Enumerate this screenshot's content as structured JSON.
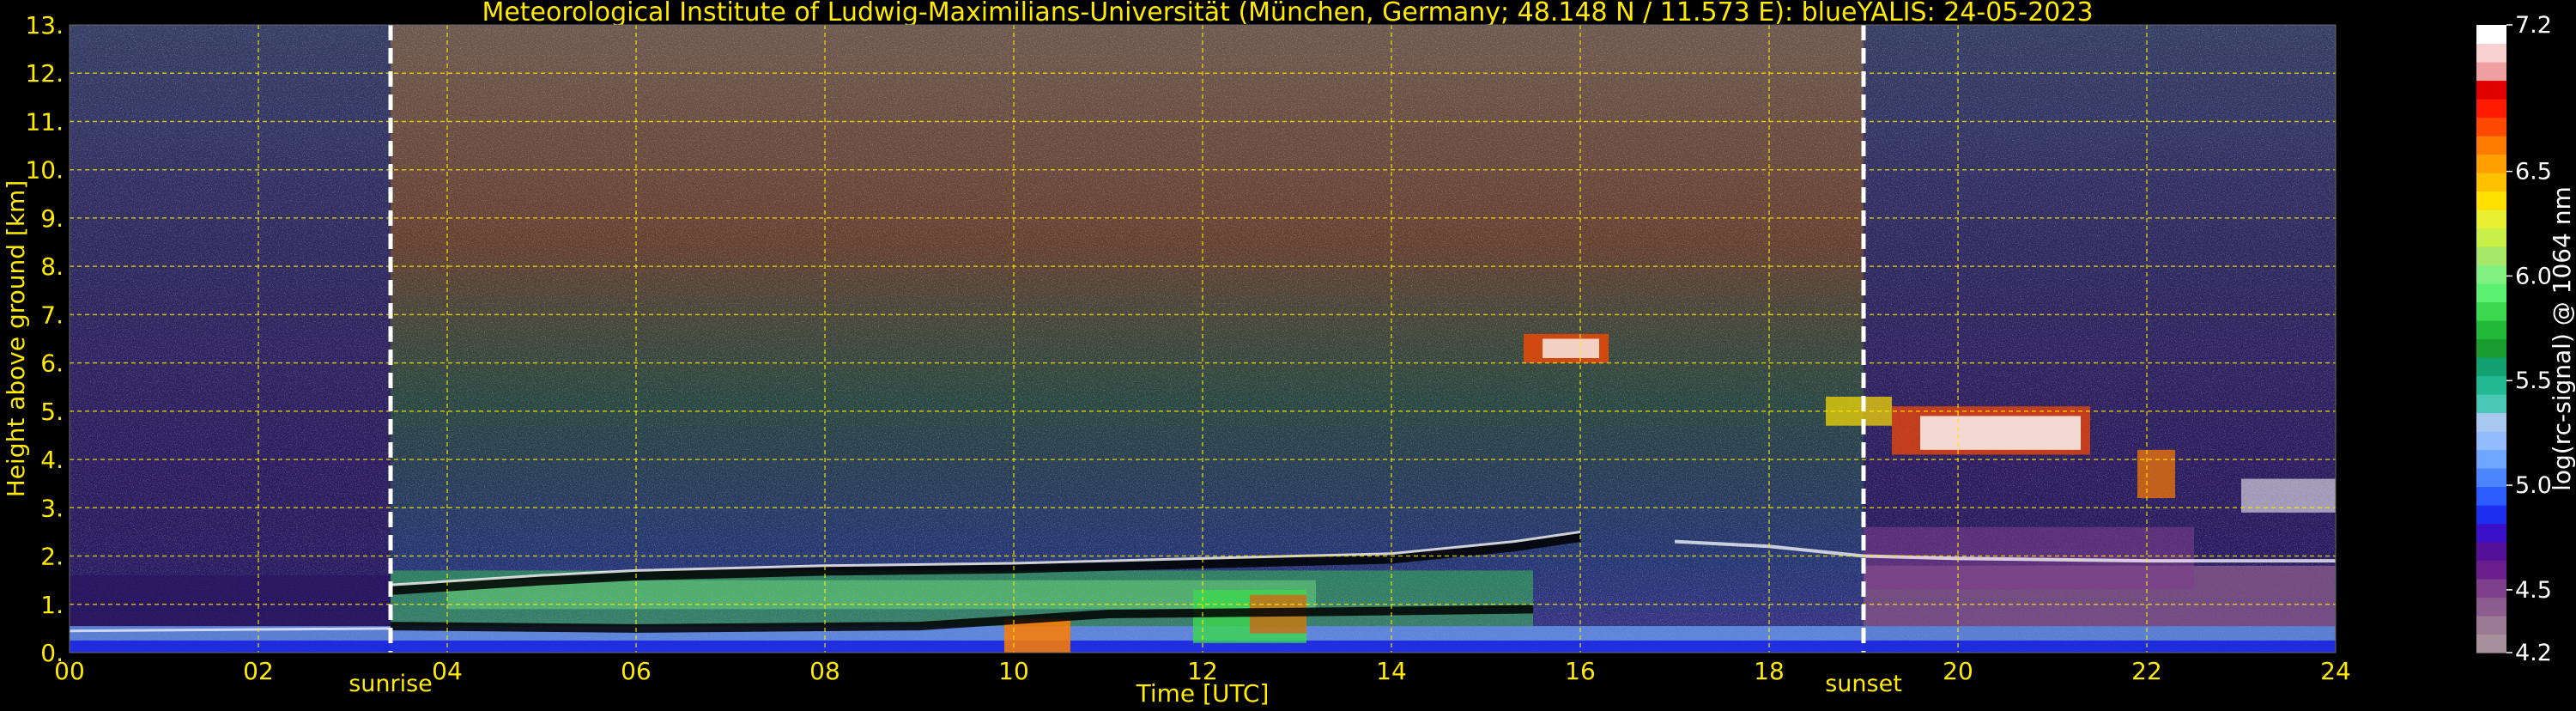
{
  "chart_data": {
    "type": "heatmap",
    "title": "Meteorological Institute of Ludwig-Maximilians-Universität (München, Germany; 48.148 N / 11.573 E):    blueYALIS: 24-05-2023",
    "xlabel": "Time [UTC]",
    "ylabel": "Height above ground [km]",
    "xlim": [
      0,
      24
    ],
    "ylim": [
      0,
      13
    ],
    "x_ticks": [
      0,
      2,
      4,
      6,
      8,
      10,
      12,
      14,
      16,
      18,
      20,
      22,
      24
    ],
    "x_tick_labels": [
      "00",
      "02",
      "04",
      "06",
      "08",
      "10",
      "12",
      "14",
      "16",
      "18",
      "20",
      "22",
      "24"
    ],
    "y_ticks": [
      0,
      1,
      2,
      3,
      4,
      5,
      6,
      7,
      8,
      9,
      10,
      11,
      12,
      13
    ],
    "y_tick_labels": [
      "0.",
      "1.",
      "2.",
      "3.",
      "4.",
      "5.",
      "6.",
      "7.",
      "8.",
      "9.",
      "10.",
      "11.",
      "12.",
      "13."
    ],
    "grid": true,
    "colorbar": {
      "label": "log(rc-signal) @ 1064 nm",
      "range": [
        4.2,
        7.2
      ],
      "ticks": [
        4.2,
        4.5,
        5.0,
        5.5,
        6.0,
        6.5,
        7.2
      ],
      "tick_labels": [
        "4.2",
        "4.5",
        "5.0",
        "5.5",
        "6.0",
        "6.5",
        "7.2"
      ],
      "colors": [
        "#a8909c",
        "#9a7a94",
        "#8c5c8e",
        "#7d3e8c",
        "#6a1f8c",
        "#55109a",
        "#3a10c8",
        "#1c2ef0",
        "#2a5cff",
        "#4b86ff",
        "#6fa6ff",
        "#93bcff",
        "#a8c8f0",
        "#48c8b4",
        "#22b890",
        "#12a070",
        "#1a9c2e",
        "#22b838",
        "#3cd850",
        "#5cf070",
        "#80f080",
        "#a8e868",
        "#c8f048",
        "#e8f030",
        "#ffe000",
        "#ffc000",
        "#ffa000",
        "#ff7c00",
        "#ff4800",
        "#ff1a00",
        "#e00000",
        "#f0a0a0",
        "#f8d0d0",
        "#ffffff"
      ]
    },
    "annotations": [
      {
        "label": "sunrise",
        "x": 3.4
      },
      {
        "label": "sunset",
        "x": 19.0
      }
    ]
  }
}
